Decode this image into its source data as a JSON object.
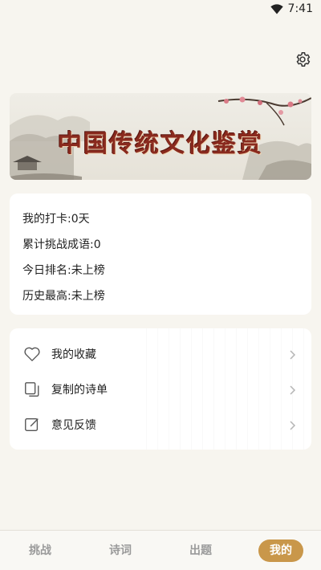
{
  "status_bar": {
    "time": "7:41"
  },
  "banner": {
    "title": "中国传统文化鉴赏"
  },
  "stats": [
    {
      "label": "我的打卡:",
      "value": "0天"
    },
    {
      "label": "累计挑战成语:",
      "value": "0"
    },
    {
      "label": "今日排名:",
      "value": "未上榜"
    },
    {
      "label": "历史最高:",
      "value": "未上榜"
    }
  ],
  "menu": [
    {
      "label": "我的收藏",
      "icon": "heart-icon"
    },
    {
      "label": "复制的诗单",
      "icon": "copy-icon"
    },
    {
      "label": "意见反馈",
      "icon": "edit-icon"
    }
  ],
  "bottom_nav": [
    {
      "label": "挑战",
      "active": false
    },
    {
      "label": "诗词",
      "active": false
    },
    {
      "label": "出题",
      "active": false
    },
    {
      "label": "我的",
      "active": true
    }
  ],
  "colors": {
    "accent": "#c9974a",
    "background": "#f7f5ef",
    "banner_title": "#8a2a1e"
  }
}
